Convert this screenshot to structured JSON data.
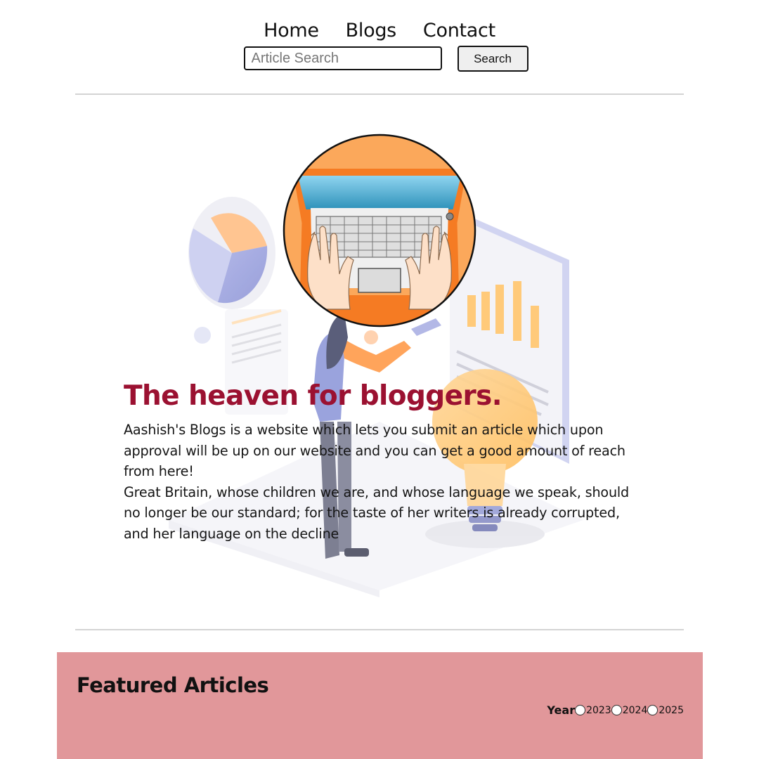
{
  "nav": {
    "home": "Home",
    "blogs": "Blogs",
    "contact": "Contact"
  },
  "search": {
    "placeholder": "Article Search",
    "value": "",
    "button_label": "Search"
  },
  "hero": {
    "title": "The heaven for bloggers.",
    "paragraph1": "Aashish's Blogs is a website which lets you submit an article which upon approval will be up on our website and you can get a good amount of reach from here!",
    "paragraph2": "Great Britain, whose children we are, and whose language we speak, should no longer be our standard; for the taste of her writers is already corrupted, and her language on the decline"
  },
  "featured": {
    "heading": "Featured Articles",
    "year_label": "Year",
    "years": [
      "2023",
      "2024",
      "2025"
    ],
    "background_color": "#e1979a"
  },
  "colors": {
    "accent_title": "#9b1131",
    "divider": "#d4d4d4"
  }
}
